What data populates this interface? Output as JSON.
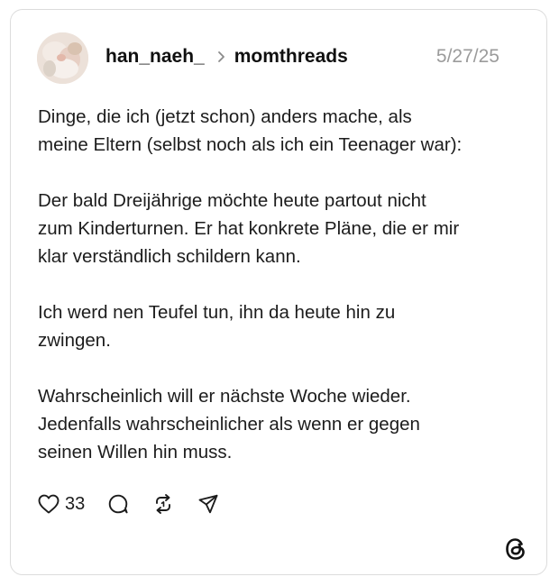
{
  "post": {
    "username": "han_naeh_",
    "community": "momthreads",
    "date": "5/27/25",
    "paragraphs": [
      "Dinge, die ich (jetzt schon) anders mache, als\nmeine Eltern (selbst noch als ich ein Teenager war):",
      "Der bald Dreijährige möchte heute partout nicht\nzum Kinderturnen. Er hat konkrete Pläne, die er mir\nklar verständlich schildern kann.",
      "Ich werd nen Teufel tun, ihn da heute hin zu\nzwingen.",
      "Wahrscheinlich will er nächste Woche wieder.\nJedenfalls wahrscheinlicher als wenn er gegen\nseinen Willen hin muss."
    ]
  },
  "actions": {
    "like_count": "33",
    "icons": [
      "heart-icon",
      "comment-icon",
      "repost-icon",
      "share-icon"
    ]
  },
  "branding": {
    "logo_icon": "threads-logo-icon"
  },
  "colors": {
    "border": "#dcdcdc",
    "date": "#9b9b9b",
    "text": "#1c1c1c"
  }
}
